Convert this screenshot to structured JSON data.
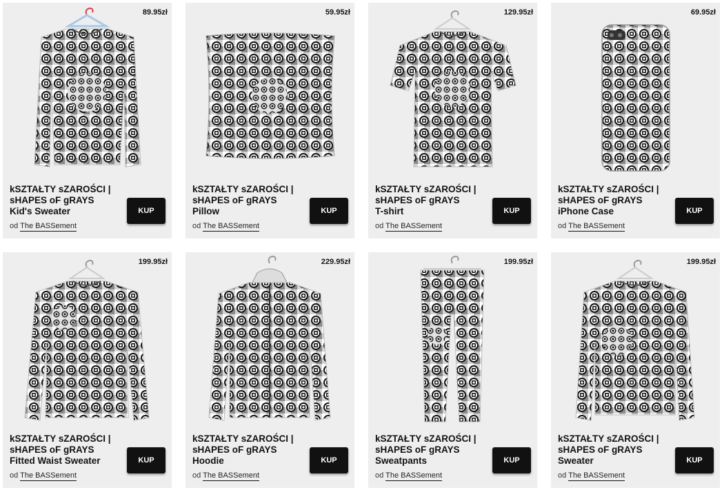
{
  "colors": {
    "card_background": "#eeeeee",
    "button_background": "#111111",
    "button_text": "#ffffff",
    "pattern_light": "#ffffff",
    "pattern_mid": "#9a9a9a",
    "pattern_dark": "#111111"
  },
  "byline_prefix": "od",
  "products": [
    {
      "title_line1": "kSZTAŁTY sZAROŚCI |",
      "title_line2": "sHAPES oF gRAYS",
      "title_line3": "Kid's Sweater",
      "price": "89.95zł",
      "seller": "The BASSement",
      "button": "KUP",
      "icon": "kids-sweater-icon"
    },
    {
      "title_line1": "kSZTAŁTY sZAROŚCI |",
      "title_line2": "sHAPES oF gRAYS",
      "title_line3": "Pillow",
      "price": "59.95zł",
      "seller": "The BASSement",
      "button": "KUP",
      "icon": "pillow-icon"
    },
    {
      "title_line1": "kSZTAŁTY sZAROŚCI |",
      "title_line2": "sHAPES oF gRAYS",
      "title_line3": "T-shirt",
      "price": "129.95zł",
      "seller": "The BASSement",
      "button": "KUP",
      "icon": "t-shirt-icon"
    },
    {
      "title_line1": "kSZTAŁTY sZAROŚCI |",
      "title_line2": "sHAPES oF gRAYS",
      "title_line3": "iPhone Case",
      "price": "69.95zł",
      "seller": "The BASSement",
      "button": "KUP",
      "icon": "phone-case-icon"
    },
    {
      "title_line1": "kSZTAŁTY sZAROŚCI |",
      "title_line2": "sHAPES oF gRAYS",
      "title_line3": "Fitted Waist Sweater",
      "price": "199.95zł",
      "seller": "The BASSement",
      "button": "KUP",
      "icon": "fitted-sweater-icon"
    },
    {
      "title_line1": "kSZTAŁTY sZAROŚCI |",
      "title_line2": "sHAPES oF gRAYS",
      "title_line3": "Hoodie",
      "price": "229.95zł",
      "seller": "The BASSement",
      "button": "KUP",
      "icon": "hoodie-icon"
    },
    {
      "title_line1": "kSZTAŁTY sZAROŚCI |",
      "title_line2": "sHAPES oF gRAYS",
      "title_line3": "Sweatpants",
      "price": "199.95zł",
      "seller": "The BASSement",
      "button": "KUP",
      "icon": "sweatpants-icon"
    },
    {
      "title_line1": "kSZTAŁTY sZAROŚCI |",
      "title_line2": "sHAPES oF gRAYS",
      "title_line3": "Sweater",
      "price": "199.95zł",
      "seller": "The BASSement",
      "button": "KUP",
      "icon": "sweater-icon"
    }
  ]
}
